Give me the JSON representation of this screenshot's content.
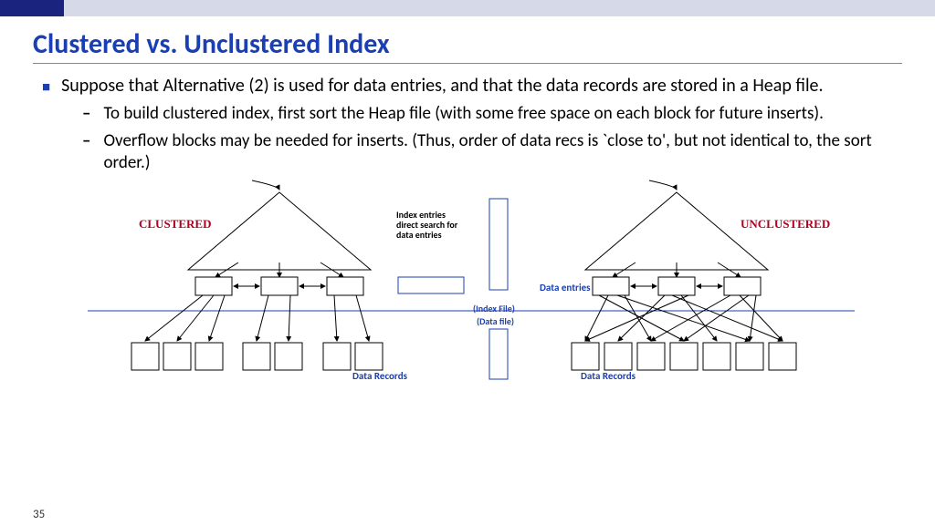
{
  "title": "Clustered vs. Unclustered Index",
  "bullets": {
    "b1": "Suppose that Alternative (2) is used for data entries, and that the data records are stored in a Heap file.",
    "b2a": "To build clustered index, first sort the Heap file (with some free space on each block for future inserts).",
    "b2b": "Overflow blocks may be needed for inserts.  (Thus, order of data recs is `close to', but not identical to, the sort order.)"
  },
  "diagram": {
    "clustered_label": "CLUSTERED",
    "unclustered_label": "UNCLUSTERED",
    "index_entries_text": "Index entries\ndirect search for\ndata entries",
    "data_entries_label": "Data entries",
    "index_file_label": "(Index File)",
    "data_file_label": "(Data file)",
    "data_records_label": "Data Records"
  },
  "slide_number": "35"
}
